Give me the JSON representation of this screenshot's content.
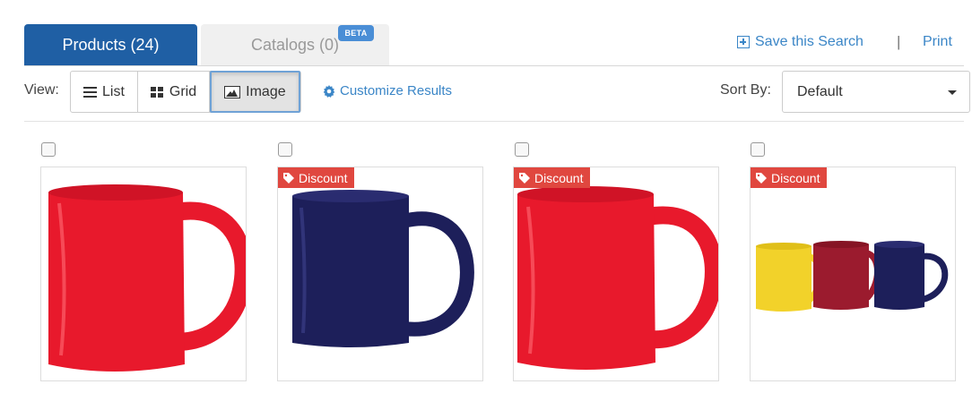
{
  "tabs": {
    "products_label": "Products (24)",
    "catalogs_label": "Catalogs (0)",
    "beta_badge": "BETA"
  },
  "links": {
    "save_search": "Save this Search",
    "separator": "|",
    "print": "Print"
  },
  "view": {
    "label": "View:",
    "options": [
      "List",
      "Grid",
      "Image"
    ],
    "active": "Image"
  },
  "customize_label": "Customize Results",
  "sort": {
    "label": "Sort By:",
    "selected": "Default"
  },
  "products": [
    {
      "badge": "",
      "mug": "single-red",
      "icon": "red-mug-icon"
    },
    {
      "badge": "Discount",
      "mug": "single-navy",
      "icon": "navy-mug-icon"
    },
    {
      "badge": "Discount",
      "mug": "single-red",
      "icon": "red-mug-icon"
    },
    {
      "badge": "Discount",
      "mug": "trio",
      "icon": "mug-trio-icon"
    }
  ],
  "colors": {
    "primary_tab": "#1f5fa4",
    "link": "#3b86c7",
    "discount": "#e0473f",
    "mug_red": "#e8192c",
    "mug_navy": "#1d1f5a",
    "mug_yellow": "#f2d22a",
    "mug_maroon": "#9b1b2e"
  }
}
